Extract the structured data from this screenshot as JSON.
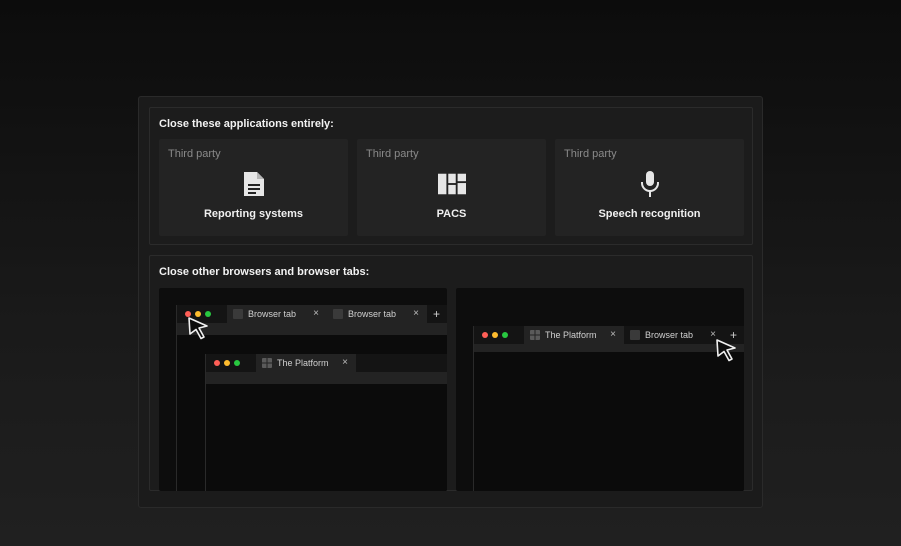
{
  "apps_section": {
    "title": "Close these applications entirely:",
    "cards": [
      {
        "category": "Third party",
        "label": "Reporting systems",
        "icon": "document-icon"
      },
      {
        "category": "Third party",
        "label": "PACS",
        "icon": "grid-layout-icon"
      },
      {
        "category": "Third party",
        "label": "Speech recognition",
        "icon": "microphone-icon"
      }
    ]
  },
  "browsers_section": {
    "title": "Close other browsers and browser tabs:",
    "left_scene": {
      "back_window_tabs": [
        {
          "label": "Browser tab",
          "close": "×"
        },
        {
          "label": "Browser tab",
          "close": "×"
        }
      ],
      "back_window_new_tab": "+",
      "front_window_tabs": [
        {
          "label": "The Platform",
          "close": "×"
        }
      ]
    },
    "right_scene": {
      "window_tabs": [
        {
          "label": "The Platform",
          "close": "×"
        },
        {
          "label": "Browser tab",
          "close": "×"
        }
      ],
      "new_tab": "+"
    }
  },
  "colors": {
    "close_dot": "#ff5f57",
    "minimize_dot": "#febc2e",
    "maximize_dot": "#28c840"
  }
}
